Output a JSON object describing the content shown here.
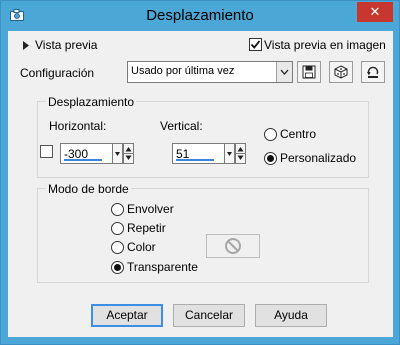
{
  "window": {
    "title": "Desplazamiento",
    "close_glyph": "✕",
    "icon": "camera-icon"
  },
  "preview": {
    "toggle_label": "Vista previa",
    "in_image_label": "Vista previa en imagen",
    "in_image_checked": true
  },
  "config": {
    "label": "Configuración",
    "selected": "Usado por última vez",
    "buttons": [
      "save-icon",
      "dice-icon",
      "reset-icon"
    ]
  },
  "offset_group": {
    "legend": "Desplazamiento",
    "horizontal_label": "Horizontal:",
    "horizontal_value": "-300",
    "vertical_label": "Vertical:",
    "vertical_value": "51",
    "link_checked": false,
    "options": [
      {
        "label": "Centro",
        "selected": false
      },
      {
        "label": "Personalizado",
        "selected": true
      }
    ]
  },
  "edge_group": {
    "legend": "Modo de borde",
    "options": [
      {
        "label": "Envolver",
        "selected": false
      },
      {
        "label": "Repetir",
        "selected": false
      },
      {
        "label": "Color",
        "selected": false
      },
      {
        "label": "Transparente",
        "selected": true
      }
    ],
    "color_swatch_icon": "no-symbol-icon"
  },
  "footer": {
    "accept": "Aceptar",
    "cancel": "Cancelar",
    "help": "Ayuda"
  },
  "colors": {
    "frame": "#4aa7d6",
    "close": "#c7372f",
    "client": "#f0f0f0",
    "focus_blue": "#3a86d4"
  }
}
